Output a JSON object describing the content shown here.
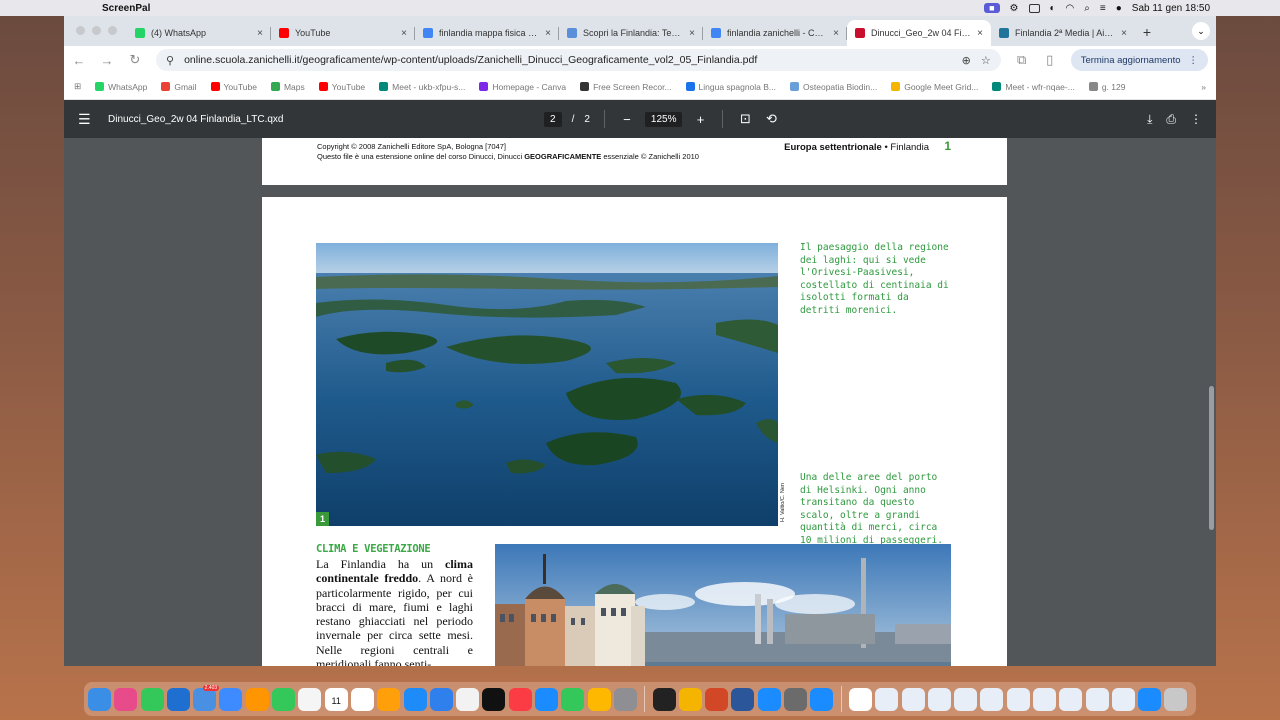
{
  "menubar": {
    "app_name": "ScreenPal",
    "date_time": "Sab 11 gen  18:50",
    "apple_glyph": ""
  },
  "tabs": [
    {
      "label": "(4) WhatsApp",
      "color": "#25d366",
      "active": false
    },
    {
      "label": "YouTube",
      "color": "#ff0000",
      "active": false
    },
    {
      "label": "finlandia mappa fisica di...",
      "color": "#4285f4",
      "active": false
    },
    {
      "label": "Scopri la Finlandia: Terri...",
      "color": "#5b8fd9",
      "active": false
    },
    {
      "label": "finlandia zanichelli - Cer...",
      "color": "#4285f4",
      "active": false
    },
    {
      "label": "Dinucci_Geo_2w 04 Finl...",
      "color": "#c8102e",
      "active": true
    },
    {
      "label": "Finlandia 2ª Media | Aiut...",
      "color": "#21759b",
      "active": false
    }
  ],
  "toolbar": {
    "url": "online.scuola.zanichelli.it/geograficamente/wp-content/uploads/Zanichelli_Dinucci_Geograficamente_vol2_05_Finlandia.pdf",
    "update_label": "Termina aggiornamento"
  },
  "bookmarks": [
    {
      "label": "WhatsApp",
      "color": "#25d366"
    },
    {
      "label": "Gmail",
      "color": "#ea4335"
    },
    {
      "label": "YouTube",
      "color": "#ff0000"
    },
    {
      "label": "Maps",
      "color": "#34a853"
    },
    {
      "label": "YouTube",
      "color": "#ff0000"
    },
    {
      "label": "Meet - ukb-xfpu-s...",
      "color": "#00897b"
    },
    {
      "label": "Homepage - Canva",
      "color": "#7d2ae8"
    },
    {
      "label": "Free Screen Recor...",
      "color": "#333333"
    },
    {
      "label": "Lingua spagnola B...",
      "color": "#1a73e8"
    },
    {
      "label": "Osteopatia Biodin...",
      "color": "#6aa0d8"
    },
    {
      "label": "Google Meet Grid...",
      "color": "#f4b400"
    },
    {
      "label": "Meet - wfr-nqae-...",
      "color": "#00897b"
    },
    {
      "label": "g. 129",
      "color": "#888888"
    }
  ],
  "pdf": {
    "title": "Dinucci_Geo_2w 04 Finlandia_LTC.qxd",
    "current_page": "2",
    "page_sep": "/",
    "total_pages": "2",
    "zoom": "125%"
  },
  "prev_page": {
    "copyright_line1": "Copyright © 2008 Zanichelli Editore SpA, Bologna [7047]",
    "copyright_line2_a": "Questo file è una estensione online del corso  Dinucci, Dinucci ",
    "copyright_line2_b": "GEOGRAFICAMENTE",
    "copyright_line2_c": " essenziale © Zanichelli 2010",
    "header_bold": "Europa settentrionale",
    "header_rest": " • Finlandia",
    "page_number": "1"
  },
  "page": {
    "photo_number": "1",
    "photo_credit": "H. Valtio/C. Nen",
    "caption1": "Il paesaggio della regione dei laghi: qui si vede l'Orivesi-Paasivesi, costellato di centinaia di isolotti formati da detriti morenici.",
    "caption2": "Una delle aree del porto di Helsinki. Ogni anno transitano da questo scalo, oltre a grandi quantità di merci, circa 10 milioni di passeggeri.",
    "section_title": "CLIMA E VEGETAZIONE",
    "body_a": "La Finlandia ha un ",
    "body_b": "clima continentale freddo",
    "body_c": ". A nord è particolarmente rigido, per cui bracci di mare, fiumi e laghi restano ghiacciati nel periodo invernale per circa sette mesi. Nelle regioni centrali e meridionali fanno senti-"
  },
  "dock": {
    "colors": [
      "#3a8ee6",
      "#e84b8a",
      "#34c759",
      "#1f6fd1",
      "#4a90e2",
      "#3d8bff",
      "#ff9500",
      "#34c759",
      "#f5f5f5",
      "#9b7b4b",
      "#ffffff",
      "#ff9f0a",
      "#1d8cf8",
      "#2f80ed",
      "#f2f2f2",
      "#111111",
      "#fc3c44",
      "#1a8cff",
      "#34c759",
      "#ffb800",
      "#8e8e93"
    ],
    "colors2": [
      "#222222",
      "#f4b400",
      "#d24726",
      "#2b579a",
      "#1a8cff",
      "#6b6b6b",
      "#1a8cff"
    ],
    "colors3": [
      "#ffffff",
      "#e8eef8",
      "#e8eef8",
      "#e8eef8",
      "#e8eef8",
      "#e8eef8",
      "#e8eef8",
      "#e8eef8",
      "#e8eef8",
      "#e8eef8",
      "#e8eef8",
      "#1a8cff",
      "#c8c8c8"
    ],
    "mail_badge": "2.403",
    "calendar_day": "11"
  }
}
